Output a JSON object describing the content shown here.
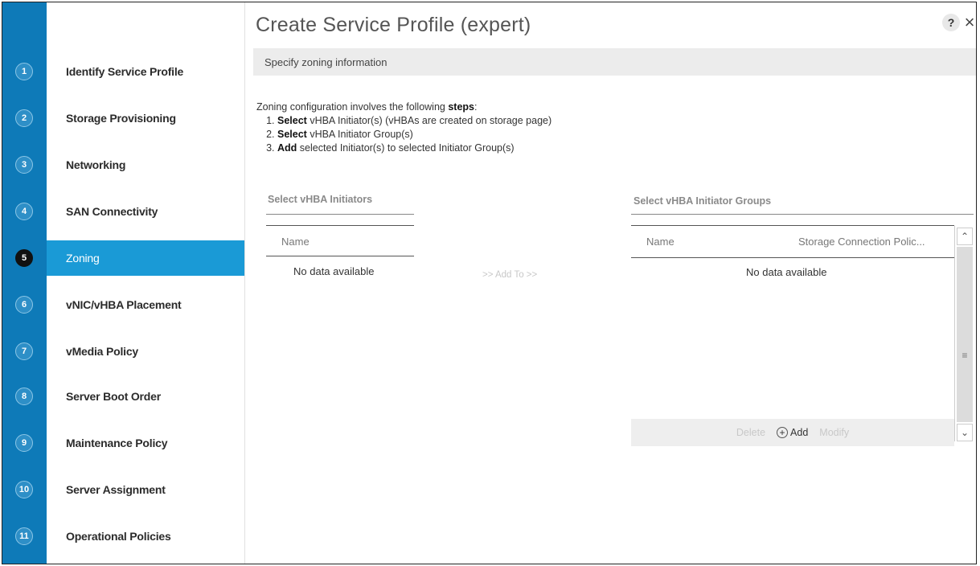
{
  "window": {
    "title": "Create Service Profile (expert)",
    "help_label": "?",
    "close_label": "×"
  },
  "steps": [
    {
      "num": "1",
      "label": "Identify Service Profile"
    },
    {
      "num": "2",
      "label": "Storage Provisioning"
    },
    {
      "num": "3",
      "label": "Networking"
    },
    {
      "num": "4",
      "label": "SAN Connectivity"
    },
    {
      "num": "5",
      "label": "Zoning"
    },
    {
      "num": "6",
      "label": "vNIC/vHBA Placement"
    },
    {
      "num": "7",
      "label": "vMedia Policy"
    },
    {
      "num": "8",
      "label": "Server Boot Order"
    },
    {
      "num": "9",
      "label": "Maintenance Policy"
    },
    {
      "num": "10",
      "label": "Server Assignment"
    },
    {
      "num": "11",
      "label": "Operational Policies"
    }
  ],
  "active_step": "5",
  "content": {
    "subheader": "Specify zoning information",
    "intro": {
      "lead": "Zoning configuration involves the following ",
      "lead_bold": "steps",
      "lead_end": ":",
      "items": [
        {
          "bold": "Select",
          "text": " vHBA Initiator(s) (vHBAs are created on storage page)"
        },
        {
          "bold": "Select",
          "text": " vHBA Initiator Group(s)"
        },
        {
          "bold": "Add",
          "text": " selected Initiator(s) to selected Initiator Group(s)"
        }
      ]
    },
    "initiators": {
      "label": "Select vHBA Initiators",
      "column": "Name",
      "empty": "No data available"
    },
    "add_to_label": ">> Add To >>",
    "groups": {
      "label": "Select vHBA Initiator Groups",
      "col_name": "Name",
      "col_policy": "Storage Connection Polic...",
      "empty": "No data available"
    },
    "toolbar": {
      "delete_label": "Delete",
      "add_label": "Add",
      "modify_label": "Modify"
    }
  }
}
